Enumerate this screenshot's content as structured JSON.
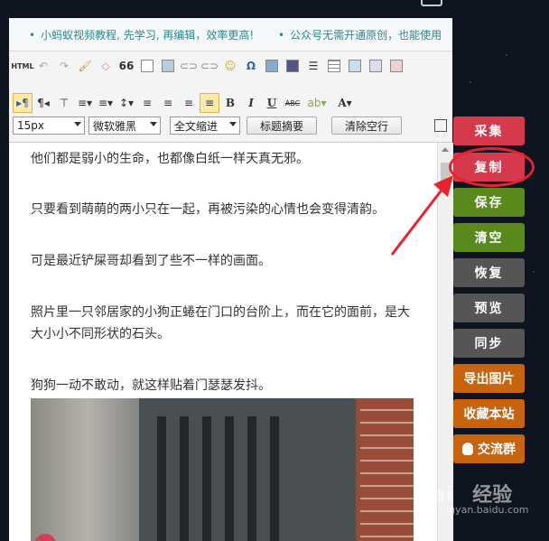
{
  "notice": {
    "left": "小蚂蚁视频教程, 先学习, 再编辑，效率更高!",
    "right": "公众号无需开通原创，也能使用"
  },
  "toolbar": {
    "html_label": "HTML",
    "quote_glyph": "66",
    "omega_glyph": "Ω",
    "bold": "B",
    "italic": "I",
    "underline": "U",
    "strike": "ABC",
    "font_color": "A",
    "font_size_value": "15px",
    "font_family_value": "微软雅黑",
    "indent_value": "全文缩进",
    "title_summary_button": "标题摘要",
    "clear_empty_lines_button": "清除空行"
  },
  "content": {
    "paragraphs": [
      "他们都是弱小的生命，也都像白纸一样天真无邪。",
      "只要看到萌萌的两小只在一起，再被污染的心情也会变得清韵。",
      "可是最近铲屎哥却看到了些不一样的画面。",
      "照片里一只邻居家的小狗正蜷在门口的台阶上，而在它的面前，是大大小小不同形状的石头。",
      "狗狗一动不敢动，就这样贴着门瑟瑟发抖。"
    ]
  },
  "side_buttons": [
    {
      "label": "采集",
      "color": "#d6394c"
    },
    {
      "label": "复制",
      "color": "#d6394c"
    },
    {
      "label": "保存",
      "color": "#5a8a1e"
    },
    {
      "label": "清空",
      "color": "#5a8a1e"
    },
    {
      "label": "恢复",
      "color": "#555555"
    },
    {
      "label": "预览",
      "color": "#555555"
    },
    {
      "label": "同步",
      "color": "#555555"
    },
    {
      "label": "导出图片",
      "color": "#c8630e"
    },
    {
      "label": "收藏本站",
      "color": "#c8630e"
    },
    {
      "label": "交流群",
      "color": "#c8630e"
    }
  ],
  "watermark": {
    "brand": "Bai",
    "brand2": "经验",
    "url": "jingyan.baidu.com"
  },
  "colors": {
    "accent_red": "#e8222a",
    "notice_text": "#2a8a8a"
  }
}
